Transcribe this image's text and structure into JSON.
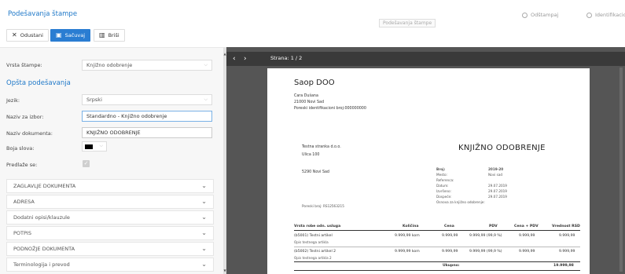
{
  "header": {
    "title": "Podešavanja štampe",
    "tooltip": "Podešavanja štampe",
    "actions": {
      "print": "Odštampaj",
      "identification": "Identifikacio"
    }
  },
  "toolbar": {
    "cancel": "Odustani",
    "save": "Sačuvaj",
    "delete": "Briši"
  },
  "form": {
    "print_type_label": "Vrsta štampe:",
    "print_type_value": "Knjižno odobrenje",
    "general_section": "Opšta podešavanja",
    "language_label": "Jezik:",
    "language_value": "Srpski",
    "choice_name_label": "Naziv za izbor:",
    "choice_name_value": "Standardno - Knjižno odobrenje",
    "doc_name_label": "Naziv dokumenta:",
    "doc_name_value": "KNJIŽNO ODOBRENJE",
    "font_color_label": "Boja slova:",
    "font_color": "#000000",
    "proposed_label": "Predlaže se:"
  },
  "accordions": [
    "ZAGLAVLJE DOKUMENTA",
    "ADRESA",
    "Dodatni opisi/klauzule",
    "POTPIS",
    "PODNOŽJE DOKUMENTA",
    "Terminologija i prevod"
  ],
  "preview": {
    "page_label": "Strana: 1 / 2"
  },
  "document": {
    "company_name": "Saop DOO",
    "company_street": "Cara Dušana",
    "company_city": "21000 Novi Sad",
    "company_tax": "Poreski identifikacioni broj:000000000",
    "customer_name": "Testna stranka d.o.o.",
    "customer_street": "Ulica 100",
    "customer_city": "5290   Novi Sad",
    "customer_tax": "Poreski broj: RS12563215",
    "title": "KNJIŽNO ODOBRENJE",
    "meta_number_label": "Broj:",
    "meta_number_value": "2019-20",
    "meta_place_label": "Mesto:",
    "meta_place_value": "Novi sad",
    "meta_ref_label": "Referenca:",
    "meta_date_label": "Datum:",
    "meta_date_value": "29.07.2019",
    "meta_issued_label": "Izvršeno:",
    "meta_issued_value": "29.07.2019",
    "meta_due_label": "Dospeće:",
    "meta_due_value": "29.07.2019",
    "basis": "Osnova za knjižno odobrenje:",
    "columns": {
      "item": "Vrsta robe odn. usluga",
      "qty": "Količina",
      "price": "Cena",
      "vat": "PDV",
      "price_vat": "Cena + PDV",
      "value": "Vrednost RSD"
    },
    "rows": [
      {
        "item": "(b5001) Testni artikel",
        "desc": "Opis testnega artikla",
        "qty": "9.999,99 kom",
        "price": "9.999,99",
        "vat": "9.999,99 (99,9 %)",
        "price_vat": "9.999,99",
        "value": "9.999,99"
      },
      {
        "item": "(b5002) Testni artikel 2",
        "desc": "Opis testnega artikla 2",
        "qty": "9.999,99 kom",
        "price": "9.999,99",
        "vat": "9.999,99 (99,9 %)",
        "price_vat": "9.999,99",
        "value": "9.999,99"
      }
    ],
    "total_label": "Ukupno:",
    "total_value": "19.999,98"
  }
}
